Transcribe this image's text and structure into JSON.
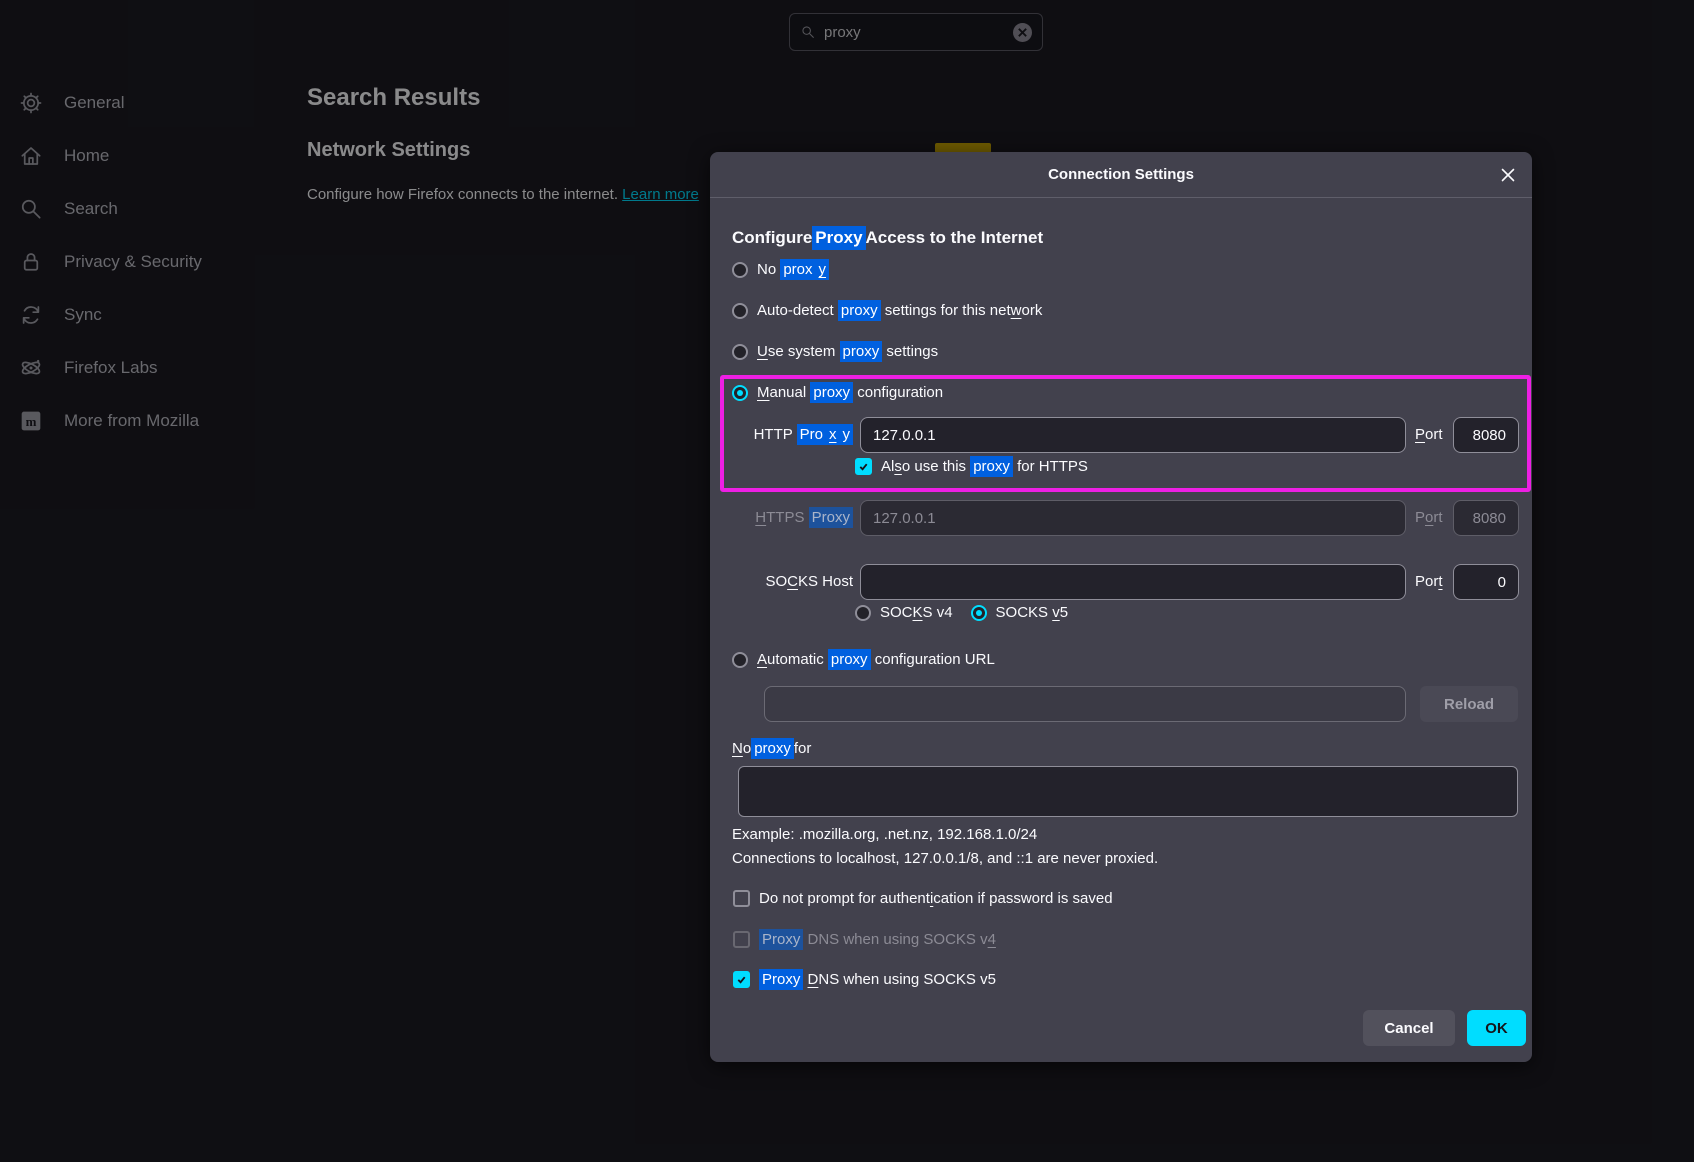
{
  "colors": {
    "page_bg": "#1c1b22",
    "dialog_bg": "#42414d",
    "accent_cyan": "#00ddff",
    "search_highlight_blue": "#0060df",
    "annotation_magenta": "#ee1fe4",
    "marker_yellow": "#c7a500"
  },
  "searchbox": {
    "icon": "search-icon",
    "value": "proxy",
    "clear_icon": "circle-x-icon"
  },
  "sidebar": {
    "items": [
      {
        "label": "General",
        "icon": "gear-icon"
      },
      {
        "label": "Home",
        "icon": "home-icon"
      },
      {
        "label": "Search",
        "icon": "search-icon"
      },
      {
        "label": "Privacy & Security",
        "icon": "lock-icon"
      },
      {
        "label": "Sync",
        "icon": "sync-icon"
      },
      {
        "label": "Firefox Labs",
        "icon": "labs-icon"
      },
      {
        "label": "More from Mozilla",
        "icon": "mozilla-icon"
      }
    ]
  },
  "content": {
    "page_title": "Search Results",
    "section_title": "Network Settings",
    "description": "Configure how Firefox connects to the internet. ",
    "link_label": "Learn more"
  },
  "dialog": {
    "title": "Connection Settings",
    "close_icon": "x-icon",
    "heading": [
      {
        "t": "Configure "
      },
      {
        "t": "Proxy",
        "hl": true
      },
      {
        "t": " Access to the Internet"
      }
    ],
    "radios": {
      "no_proxy": {
        "selected": false,
        "label": [
          {
            "t": "No "
          },
          {
            "t": "prox",
            "hl": true
          },
          {
            "t": "y",
            "hl": true,
            "u": true
          }
        ]
      },
      "auto_detect": {
        "selected": false,
        "label": [
          {
            "t": "Auto-detect "
          },
          {
            "t": "proxy",
            "hl": true
          },
          {
            "t": " settings for this net"
          },
          {
            "t": "w",
            "u": true
          },
          {
            "t": "ork"
          }
        ]
      },
      "use_system": {
        "selected": false,
        "label": [
          {
            "t": "U",
            "u": true
          },
          {
            "t": "se system "
          },
          {
            "t": "proxy",
            "hl": true
          },
          {
            "t": " settings"
          }
        ]
      },
      "manual": {
        "selected": true,
        "label": [
          {
            "t": "M",
            "u": true
          },
          {
            "t": "anual "
          },
          {
            "t": "proxy",
            "hl": true
          },
          {
            "t": " configuration"
          }
        ]
      },
      "auto_url": {
        "selected": false,
        "label": [
          {
            "t": "A",
            "u": true
          },
          {
            "t": "utomatic "
          },
          {
            "t": "proxy",
            "hl": true
          },
          {
            "t": " configuration URL"
          }
        ]
      }
    },
    "fields": {
      "http": {
        "disabled": false,
        "value": "127.0.0.1",
        "port_value": "8080",
        "label": [
          {
            "t": "HTTP "
          },
          {
            "t": "Pro",
            "hl": true
          },
          {
            "t": "x",
            "hl": true,
            "u": true
          },
          {
            "t": "y",
            "hl": true
          }
        ],
        "port_label": [
          {
            "t": "P",
            "u": true
          },
          {
            "t": "ort"
          }
        ]
      },
      "https": {
        "disabled": true,
        "value": "127.0.0.1",
        "port_value": "8080",
        "label": [
          {
            "t": "H",
            "u": true
          },
          {
            "t": "TTPS "
          },
          {
            "t": "Proxy",
            "hl": true
          }
        ],
        "port_label": [
          {
            "t": "P"
          },
          {
            "t": "o",
            "u": true
          },
          {
            "t": "rt"
          }
        ]
      },
      "socks": {
        "disabled": false,
        "value": "",
        "port_value": "0",
        "label": [
          {
            "t": "SO"
          },
          {
            "t": "C",
            "u": true
          },
          {
            "t": "KS Host"
          }
        ],
        "port_label": [
          {
            "t": "Por"
          },
          {
            "t": "t",
            "u": true
          }
        ]
      },
      "url": {
        "disabled": true,
        "value": ""
      },
      "no_proxy_list": {
        "value": "",
        "label": [
          {
            "t": "N",
            "u": true
          },
          {
            "t": "o "
          },
          {
            "t": "proxy",
            "hl": true
          },
          {
            "t": " for"
          }
        ]
      }
    },
    "socks_version": {
      "v4": {
        "selected": false,
        "label": [
          {
            "t": "SOC"
          },
          {
            "t": "K",
            "u": true
          },
          {
            "t": "S v4"
          }
        ]
      },
      "v5": {
        "selected": true,
        "label": [
          {
            "t": "SOCKS "
          },
          {
            "t": "v",
            "u": true
          },
          {
            "t": "5"
          }
        ]
      }
    },
    "checkboxes": {
      "share_proxy": {
        "checked": true,
        "disabled": false,
        "label": [
          {
            "t": "Al"
          },
          {
            "t": "s",
            "u": true
          },
          {
            "t": "o use this "
          },
          {
            "t": "proxy",
            "hl": true
          },
          {
            "t": " for HTTPS"
          }
        ]
      },
      "no_auth_prompt": {
        "checked": false,
        "disabled": false,
        "label": [
          {
            "t": "Do not prompt for authent"
          },
          {
            "t": "i",
            "u": true
          },
          {
            "t": "cation if password is saved"
          }
        ]
      },
      "socks4_dns": {
        "checked": false,
        "disabled": true,
        "label": [
          {
            "t": "Proxy",
            "hl": true
          },
          {
            "t": " DNS when using SOCKS v"
          },
          {
            "t": "4",
            "u": true
          }
        ]
      },
      "socks5_dns": {
        "checked": true,
        "disabled": false,
        "label": [
          {
            "t": "Proxy",
            "hl": true
          },
          {
            "t": " "
          },
          {
            "t": "D",
            "u": true
          },
          {
            "t": "NS when using SOCKS v5"
          }
        ]
      }
    },
    "notes": [
      "Example: .mozilla.org, .net.nz, 192.168.1.0/24",
      "Connections to localhost, 127.0.0.1/8, and ::1 are never proxied."
    ],
    "buttons": {
      "reload": "Reload",
      "cancel": "Cancel",
      "ok": "OK"
    }
  }
}
